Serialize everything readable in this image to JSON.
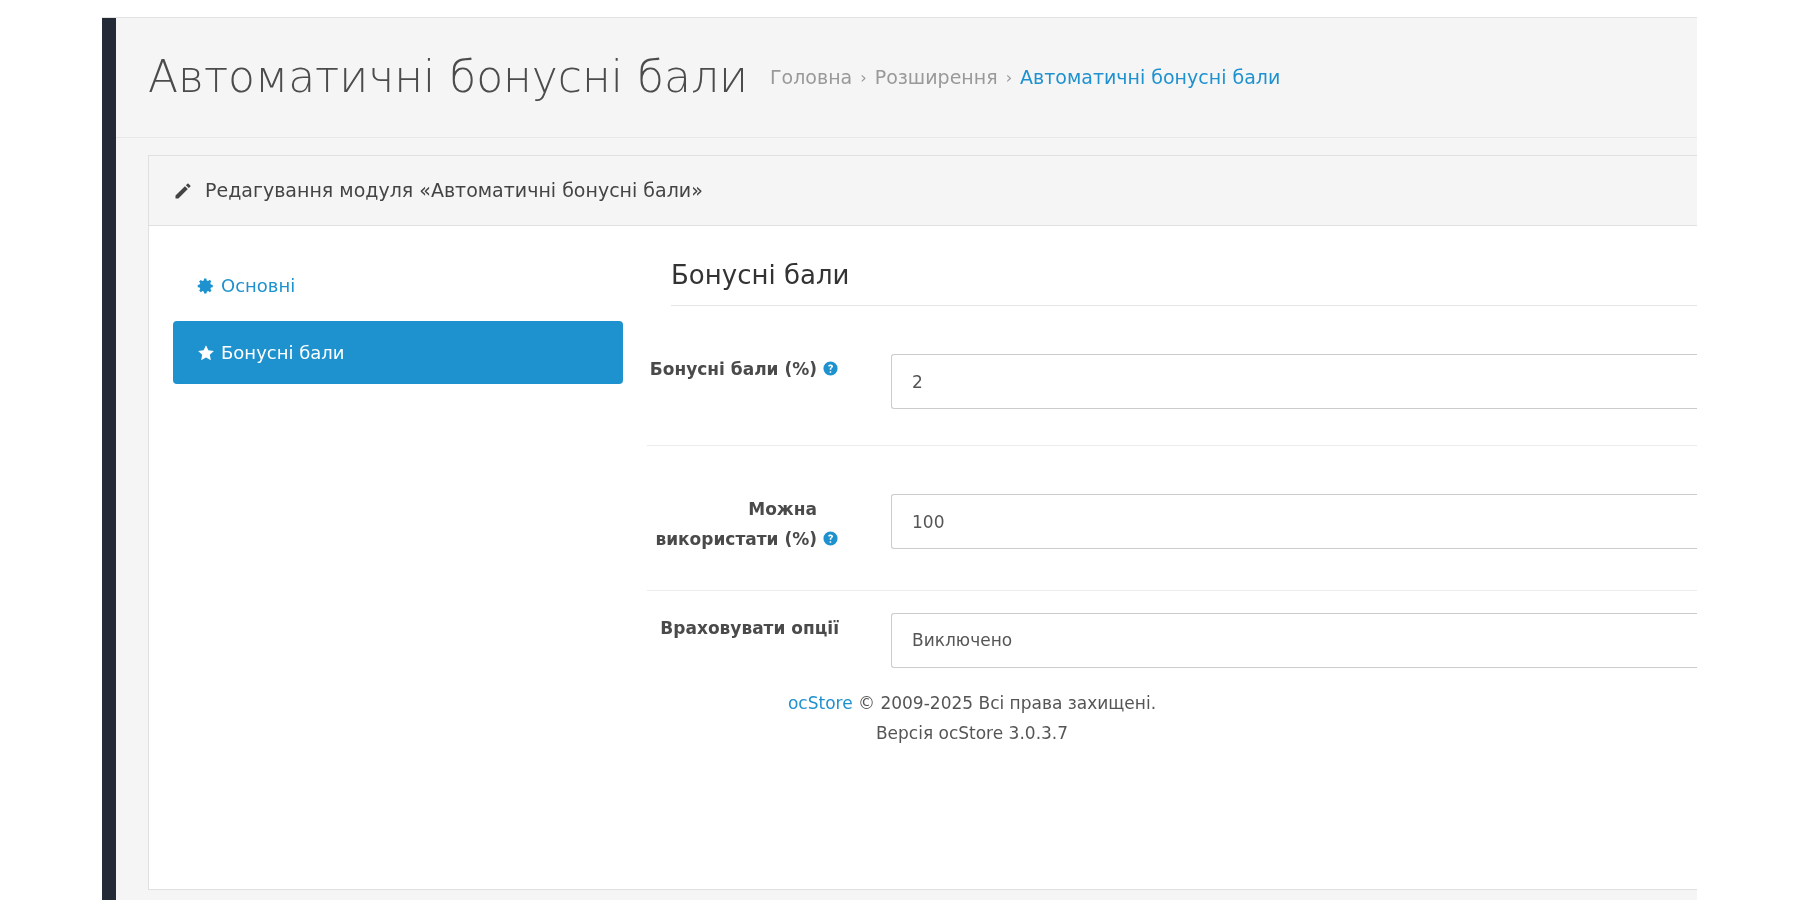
{
  "page_title": "Автоматичні бонусні бали",
  "breadcrumb": [
    {
      "label": "Головна",
      "current": false
    },
    {
      "separator": "›",
      "label": "Розширення",
      "current": false
    },
    {
      "separator": "›",
      "label": "Автоматичні бонусні бали",
      "current": true
    }
  ],
  "panel": {
    "title": "Редагування модуля «Автоматичні бонусні бали»"
  },
  "tabs": [
    {
      "label": "Основні",
      "kind": "gear",
      "selected": false
    },
    {
      "label": "Бонусні бали",
      "kind": "star",
      "selected": true
    }
  ],
  "section_title": "Бонусні бали",
  "fields": [
    {
      "kind": "input",
      "label": "Бонусні бали (%)",
      "help": true,
      "value": "2"
    },
    {
      "kind": "input",
      "label": "Можна використати (%)",
      "help": true,
      "value": "100"
    },
    {
      "kind": "select",
      "label": "Враховувати опції",
      "help": false,
      "value": "Виключено"
    }
  ],
  "footer": {
    "link": "ocStore",
    "text": "© 2009-2025 Всі права захищені.",
    "version": "Версія ocStore 3.0.3.7"
  }
}
